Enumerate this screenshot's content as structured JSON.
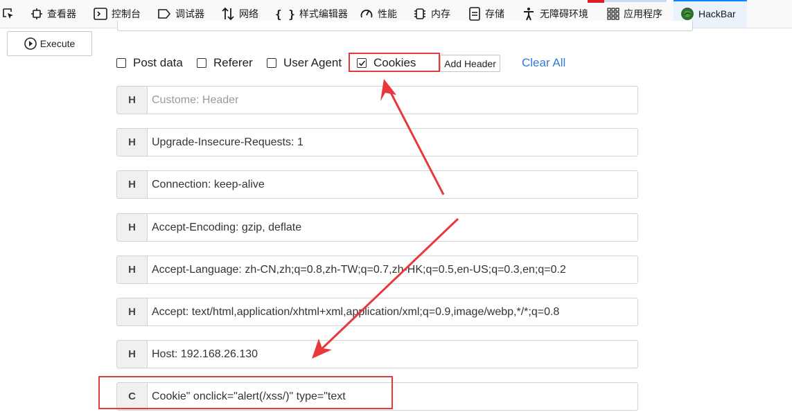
{
  "devtools": {
    "tabs": [
      {
        "label": "查看器",
        "icon": "inspector-icon"
      },
      {
        "label": "控制台",
        "icon": "console-icon"
      },
      {
        "label": "调试器",
        "icon": "debugger-icon"
      },
      {
        "label": "网络",
        "icon": "network-icon"
      },
      {
        "label": "样式编辑器",
        "icon": "style-editor-icon"
      },
      {
        "label": "性能",
        "icon": "performance-icon"
      },
      {
        "label": "内存",
        "icon": "memory-icon"
      },
      {
        "label": "存储",
        "icon": "storage-icon"
      },
      {
        "label": "无障碍环境",
        "icon": "accessibility-icon"
      },
      {
        "label": "应用程序",
        "icon": "application-icon"
      },
      {
        "label": "HackBar",
        "icon": "hackbar-icon"
      }
    ],
    "active_tab": "HackBar",
    "picker_icon": "element-picker-icon"
  },
  "hackbar": {
    "execute_label": "Execute",
    "options": [
      {
        "label": "Post data",
        "checked": false
      },
      {
        "label": "Referer",
        "checked": false
      },
      {
        "label": "User Agent",
        "checked": false
      },
      {
        "label": "Cookies",
        "checked": true
      }
    ],
    "add_header_label": "Add Header",
    "clear_all_label": "Clear All",
    "headers": [
      {
        "tag": "H",
        "value": "",
        "placeholder": "Custome: Header"
      },
      {
        "tag": "H",
        "value": "Upgrade-Insecure-Requests: 1"
      },
      {
        "tag": "H",
        "value": "Connection: keep-alive"
      },
      {
        "tag": "H",
        "value": "Accept-Encoding: gzip, deflate"
      },
      {
        "tag": "H",
        "value": "Accept-Language: zh-CN,zh;q=0.8,zh-TW;q=0.7,zh-HK;q=0.5,en-US;q=0.3,en;q=0.2"
      },
      {
        "tag": "H",
        "value": "Accept: text/html,application/xhtml+xml,application/xml;q=0.9,image/webp,*/*;q=0.8"
      },
      {
        "tag": "H",
        "value": "Host: 192.168.26.130"
      },
      {
        "tag": "C",
        "value": "Cookie\" onclick=\"alert(/xss/)\" type=\"text"
      }
    ]
  },
  "colors": {
    "annotation_red": "#e8383d",
    "link_blue": "#2f7bd2",
    "active_tab_accent": "#0a84ff"
  }
}
